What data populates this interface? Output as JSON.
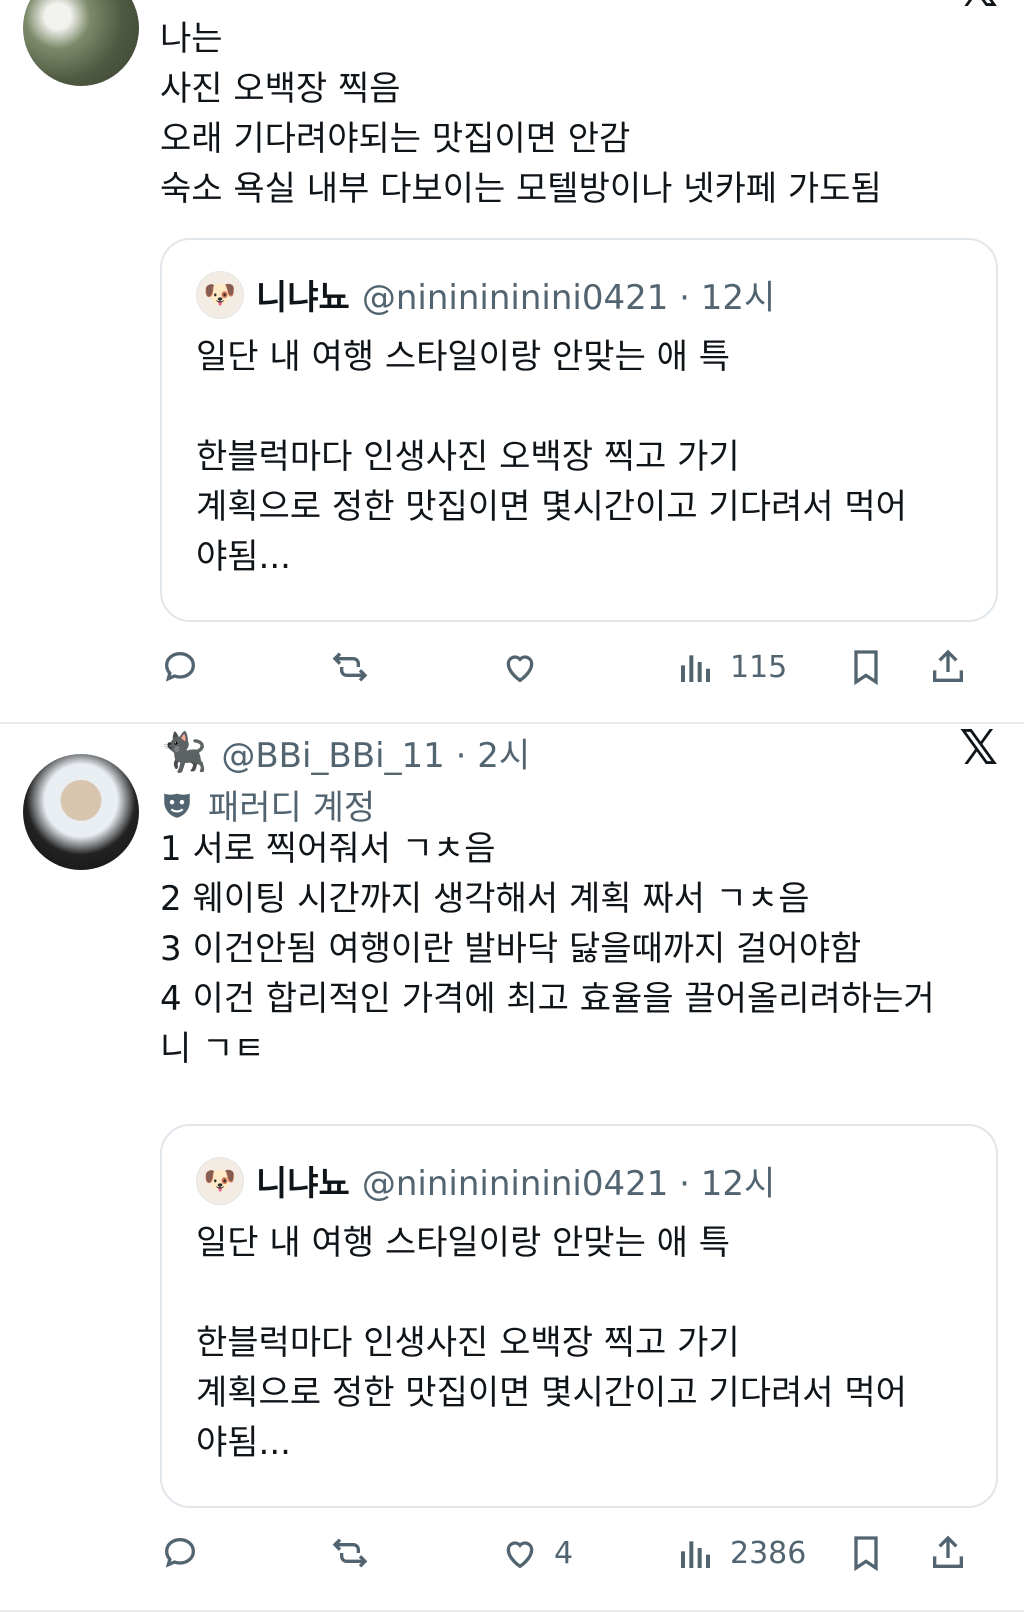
{
  "tweet1": {
    "body": [
      "나는",
      "사진 오백장 찍음",
      "오래 기다려야되는 맛집이면 안감",
      "숙소 욕실 내부 다보이는 모텔방이나 넷카페 가도됨"
    ],
    "quote": {
      "name": "니냐뇨",
      "handle": "@nininininini0421 · 12시",
      "body": [
        "일단 내 여행 스타일이랑 안맞는 애 특",
        "",
        "한블럭마다 인생사진 오백장 찍고 가기",
        "계획으로 정한 맛집이면 몇시간이고 기다려서 먹어",
        "야됨..."
      ]
    },
    "views": "115"
  },
  "tweet2": {
    "handle": "@BBi_BBi_11 · 2시",
    "parody_label": "패러디 계정",
    "body": [
      "1 서로 찍어줘서 ㄱㅊ음",
      "2 웨이팅 시간까지 생각해서 계획 짜서 ㄱㅊ음",
      "3 이건안됨 여행이란 발바닥 닳을때까지 걸어야함",
      "4 이건 합리적인 가격에 최고 효율을 끌어올리려하는거",
      "니 ㄱㅌ"
    ],
    "quote": {
      "name": "니냐뇨",
      "handle": "@nininininini0421 · 12시",
      "body": [
        "일단 내 여행 스타일이랑 안맞는 애 특",
        "",
        "한블럭마다 인생사진 오백장 찍고 가기",
        "계획으로 정한 맛집이면 몇시간이고 기다려서 먹어",
        "야됨..."
      ]
    },
    "likes": "4",
    "views": "2386"
  },
  "icons": {
    "reply": "reply-icon",
    "retweet": "retweet-icon",
    "like": "heart-icon",
    "views": "views-icon",
    "bookmark": "bookmark-icon",
    "share": "share-icon",
    "platform": "x-logo-icon"
  },
  "colors": {
    "text": "#0f1419",
    "secondary": "#536471",
    "border": "#e1e6ea"
  }
}
